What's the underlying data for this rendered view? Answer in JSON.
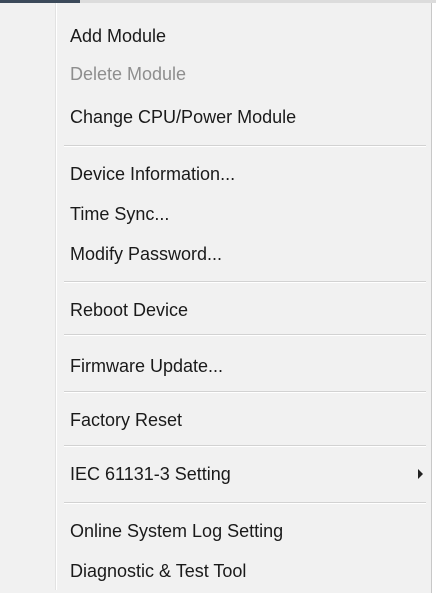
{
  "menu": {
    "items": [
      {
        "label": "Add Module",
        "disabled": false
      },
      {
        "label": "Delete Module",
        "disabled": true
      },
      {
        "label": "Change CPU/Power Module",
        "disabled": false
      },
      {
        "label": "Device Information...",
        "disabled": false
      },
      {
        "label": "Time Sync...",
        "disabled": false
      },
      {
        "label": "Modify Password...",
        "disabled": false
      },
      {
        "label": "Reboot Device",
        "disabled": false
      },
      {
        "label": "Firmware Update...",
        "disabled": false
      },
      {
        "label": "Factory Reset",
        "disabled": false
      },
      {
        "label": "IEC 61131-3 Setting",
        "disabled": false,
        "submenu": true
      },
      {
        "label": "Online System Log Setting",
        "disabled": false
      },
      {
        "label": "Diagnostic & Test Tool",
        "disabled": false
      }
    ]
  }
}
